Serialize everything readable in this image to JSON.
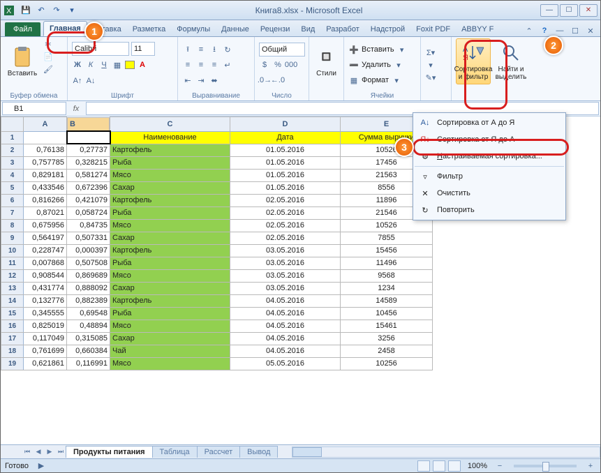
{
  "window": {
    "title": "Книга8.xlsx - Microsoft Excel"
  },
  "tabs": {
    "file": "Файл",
    "home": "Главная",
    "insert": "Вставка",
    "layout": "Разметка",
    "formulas": "Формулы",
    "data": "Данные",
    "review": "Рецензи",
    "view": "Вид",
    "dev": "Разработ",
    "addins": "Надстрой",
    "foxit": "Foxit PDF",
    "abbyy": "ABBYY F"
  },
  "groups": {
    "clipboard": {
      "label": "Буфер обмена",
      "paste": "Вставить"
    },
    "font": {
      "label": "Шрифт",
      "family": "Calibri",
      "size": "11"
    },
    "align": {
      "label": "Выравнивание"
    },
    "number": {
      "label": "Число",
      "format": "Общий"
    },
    "styles": {
      "label": "Стили"
    },
    "cells": {
      "label": "Ячейки",
      "insert": "Вставить",
      "delete": "Удалить",
      "format": "Формат"
    },
    "edit": {
      "sort": "Сортировка и фильтр",
      "find": "Найти и выделить"
    }
  },
  "namebox": "B1",
  "cols": {
    "A": "A",
    "B": "B",
    "C": "C",
    "D": "D",
    "E": "E"
  },
  "colw": {
    "a": 62,
    "b": 62,
    "c": 172,
    "d": 158,
    "e": 132
  },
  "headers": {
    "c": "Наименование",
    "d": "Дата",
    "e": "Сумма выручки"
  },
  "rows": [
    {
      "n": 2,
      "a": "0,76138",
      "b": "0,27737",
      "c": "Картофель",
      "d": "01.05.2016",
      "e": "10526"
    },
    {
      "n": 3,
      "a": "0,757785",
      "b": "0,328215",
      "c": "Рыба",
      "d": "01.05.2016",
      "e": "17456"
    },
    {
      "n": 4,
      "a": "0,829181",
      "b": "0,581274",
      "c": "Мясо",
      "d": "01.05.2016",
      "e": "21563"
    },
    {
      "n": 5,
      "a": "0,433546",
      "b": "0,672396",
      "c": "Сахар",
      "d": "01.05.2016",
      "e": "8556"
    },
    {
      "n": 6,
      "a": "0,816266",
      "b": "0,421079",
      "c": "Картофель",
      "d": "02.05.2016",
      "e": "11896"
    },
    {
      "n": 7,
      "a": "0,87021",
      "b": "0,058724",
      "c": "Рыба",
      "d": "02.05.2016",
      "e": "21546"
    },
    {
      "n": 8,
      "a": "0,675956",
      "b": "0,84735",
      "c": "Мясо",
      "d": "02.05.2016",
      "e": "10526"
    },
    {
      "n": 9,
      "a": "0,564197",
      "b": "0,507331",
      "c": "Сахар",
      "d": "02.05.2016",
      "e": "7855"
    },
    {
      "n": 10,
      "a": "0,228747",
      "b": "0,000397",
      "c": "Картофель",
      "d": "03.05.2016",
      "e": "15456"
    },
    {
      "n": 11,
      "a": "0,007868",
      "b": "0,507508",
      "c": "Рыба",
      "d": "03.05.2016",
      "e": "11496"
    },
    {
      "n": 12,
      "a": "0,908544",
      "b": "0,869689",
      "c": "Мясо",
      "d": "03.05.2016",
      "e": "9568"
    },
    {
      "n": 13,
      "a": "0,431774",
      "b": "0,888092",
      "c": "Сахар",
      "d": "03.05.2016",
      "e": "1234"
    },
    {
      "n": 14,
      "a": "0,132776",
      "b": "0,882389",
      "c": "Картофель",
      "d": "04.05.2016",
      "e": "14589"
    },
    {
      "n": 15,
      "a": "0,345555",
      "b": "0,69548",
      "c": "Рыба",
      "d": "04.05.2016",
      "e": "10456"
    },
    {
      "n": 16,
      "a": "0,825019",
      "b": "0,48894",
      "c": "Мясо",
      "d": "04.05.2016",
      "e": "15461"
    },
    {
      "n": 17,
      "a": "0,117049",
      "b": "0,315085",
      "c": "Сахар",
      "d": "04.05.2016",
      "e": "3256"
    },
    {
      "n": 18,
      "a": "0,761699",
      "b": "0,660384",
      "c": "Чай",
      "d": "04.05.2016",
      "e": "2458"
    },
    {
      "n": 19,
      "a": "0,621861",
      "b": "0,116991",
      "c": "Мясо",
      "d": "05.05.2016",
      "e": "10256"
    }
  ],
  "sheets": {
    "s1": "Продукты питания",
    "s2": "Таблица",
    "s3": "Рассчет",
    "s4": "Вывод"
  },
  "status": {
    "ready": "Готово",
    "zoom": "100%"
  },
  "menu": {
    "az": "Сортировка от А до Я",
    "za": "Сортировка от Я до А",
    "custom": "Настраиваемая сортировка...",
    "filter": "Фильтр",
    "clear": "Очистить",
    "reapply": "Повторить"
  },
  "callouts": {
    "c1": "1",
    "c2": "2",
    "c3": "3"
  }
}
